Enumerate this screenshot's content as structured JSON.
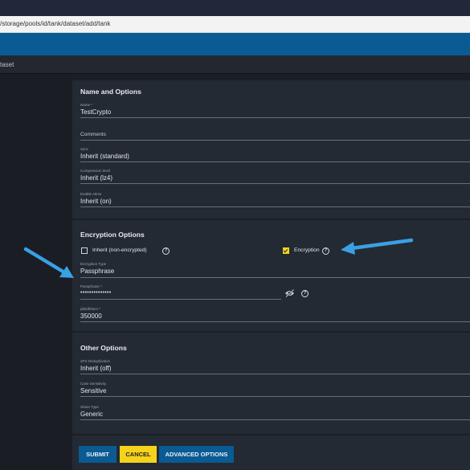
{
  "browser": {
    "url": "/storage/pools/id/tank/dataset/add/tank"
  },
  "breadcrumb": "taset",
  "sections": {
    "name_options": "Name and Options",
    "encryption": "Encryption Options",
    "other": "Other Options"
  },
  "fields": {
    "name": {
      "label": "Name *",
      "value": "TestCrypto"
    },
    "comments": {
      "placeholder": "Comments"
    },
    "sync": {
      "label": "Sync",
      "value": "Inherit (standard)"
    },
    "compression": {
      "label": "Compression level",
      "value": "Inherit (lz4)"
    },
    "atime": {
      "label": "Enable Atime",
      "value": "Inherit (on)"
    },
    "encryption_type": {
      "label": "Encryption Type",
      "value": "Passphrase"
    },
    "passphrase": {
      "label": "Passphrase *",
      "value": "••••••••••••••"
    },
    "pbkdf2iters": {
      "label": "pbkdf2iters *",
      "value": "350000"
    },
    "dedup": {
      "label": "ZFS Deduplication",
      "value": "Inherit (off)"
    },
    "case": {
      "label": "Case Sensitivity",
      "value": "Sensitive"
    },
    "share_type": {
      "label": "Share Type",
      "value": "Generic"
    }
  },
  "checkboxes": {
    "inherit": {
      "label": "Inherit (non-encrypted)",
      "checked": false
    },
    "encryption": {
      "label": "Encryption",
      "checked": true
    }
  },
  "buttons": {
    "submit": "SUBMIT",
    "cancel": "CANCEL",
    "advanced": "ADVANCED OPTIONS"
  },
  "help_glyph": "?",
  "icons": [
    "help-icon",
    "eye-off-icon"
  ],
  "colors": {
    "accent_blue": "#0a5a93",
    "accent_yellow": "#f5d21c",
    "annotation_arrow": "#3aa0e4",
    "panel": "#232a33"
  }
}
